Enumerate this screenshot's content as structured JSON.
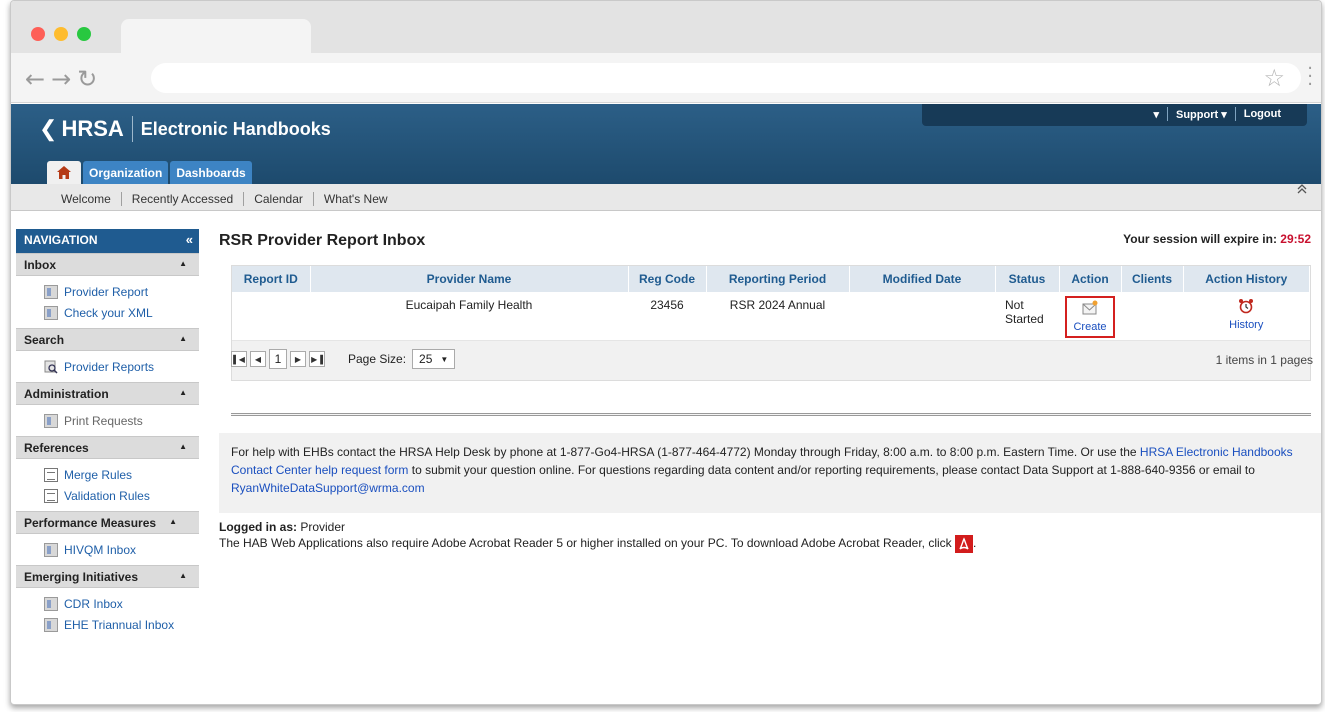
{
  "header": {
    "brand": "HRSA",
    "app_title": "Electronic Handbooks",
    "top_menu": {
      "dropdown_caret": "▾",
      "support": "Support ▾",
      "logout": "Logout"
    },
    "home_icon": "home-icon",
    "tabs": [
      "Organization",
      "Dashboards"
    ],
    "subnav": [
      "Welcome",
      "Recently Accessed",
      "Calendar",
      "What's New"
    ]
  },
  "nav": {
    "title": "NAVIGATION",
    "sections": {
      "inbox": {
        "title": "Inbox",
        "items": [
          "Provider Report",
          "Check your XML"
        ]
      },
      "search": {
        "title": "Search",
        "items": [
          "Provider Reports"
        ]
      },
      "administration": {
        "title": "Administration",
        "items": [
          "Print Requests"
        ]
      },
      "references": {
        "title": "References",
        "items": [
          "Merge Rules",
          "Validation Rules"
        ]
      },
      "performance": {
        "title": "Performance Measures",
        "items": [
          "HIVQM Inbox"
        ]
      },
      "emerging": {
        "title": "Emerging Initiatives",
        "items": [
          "CDR Inbox",
          "EHE Triannual Inbox"
        ]
      }
    }
  },
  "main": {
    "title": "RSR Provider Report Inbox",
    "session_label": "Your session will expire in:",
    "session_time": "29:52",
    "columns": [
      "Report ID",
      "Provider Name",
      "Reg Code",
      "Reporting Period",
      "Modified Date",
      "Status",
      "Action",
      "Clients",
      "Action History"
    ],
    "rows": [
      {
        "report_id": "",
        "provider_name": "Eucaipah Family Health",
        "reg_code": "23456",
        "reporting_period": "RSR 2024 Annual",
        "modified_date": "",
        "status_line1": "Not",
        "status_line2": "Started",
        "action_label": "Create",
        "clients": "",
        "history_label": "History"
      }
    ],
    "pager": {
      "current_page": "1",
      "page_size_label": "Page Size:",
      "page_size": "25",
      "items_text": "1 items in 1 pages"
    }
  },
  "help": {
    "text1": "For help with EHBs contact the HRSA Help Desk by phone at 1-877-Go4-HRSA (1-877-464-4772) Monday through Friday, 8:00 a.m. to 8:00 p.m. Eastern Time. Or use the ",
    "link1": "HRSA Electronic Handbooks Contact Center help request form",
    "text2": " to submit your question online. For questions regarding data content and/or reporting requirements, please contact Data Support at 1-888-640-9356 or email to ",
    "email": "RyanWhiteDataSupport@wrma.com"
  },
  "footer": {
    "logged_label": "Logged in as:",
    "logged_user": "Provider",
    "acrobat_text": "The HAB Web Applications also require Adobe Acrobat Reader 5 or higher installed on your PC. To download Adobe Acrobat Reader, click",
    "acrobat_end": "."
  },
  "colors": {
    "header_blue": "#1d4a6d",
    "tab_blue": "#3d84c4",
    "nav_head": "#1f5b90",
    "session_red": "#c8102e",
    "highlight_red": "#d4201f"
  }
}
